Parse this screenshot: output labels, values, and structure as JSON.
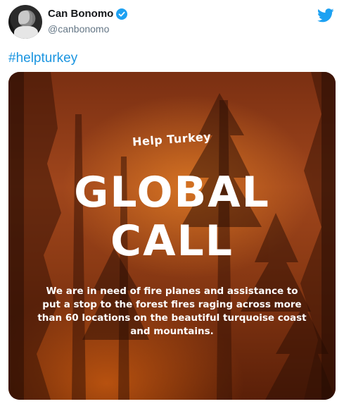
{
  "author": {
    "display_name": "Can Bonomo",
    "handle": "@canbonomo",
    "verified": true,
    "avatar_icon": "avatar-photo"
  },
  "brand": {
    "icon": "twitter-bird-icon",
    "color": "#1da1f2"
  },
  "tweet": {
    "text": "#helpturkey",
    "link_color": "#1b95e0"
  },
  "media": {
    "background": "forest-fire-image",
    "tagline": "Help Turkey",
    "headline_line1": "GLOBAL",
    "headline_line2": "CALL",
    "body": "We are in need of fire planes and assistance to put a stop to the forest fires raging across more than 60 locations on the beautiful turquoise coast and mountains."
  }
}
